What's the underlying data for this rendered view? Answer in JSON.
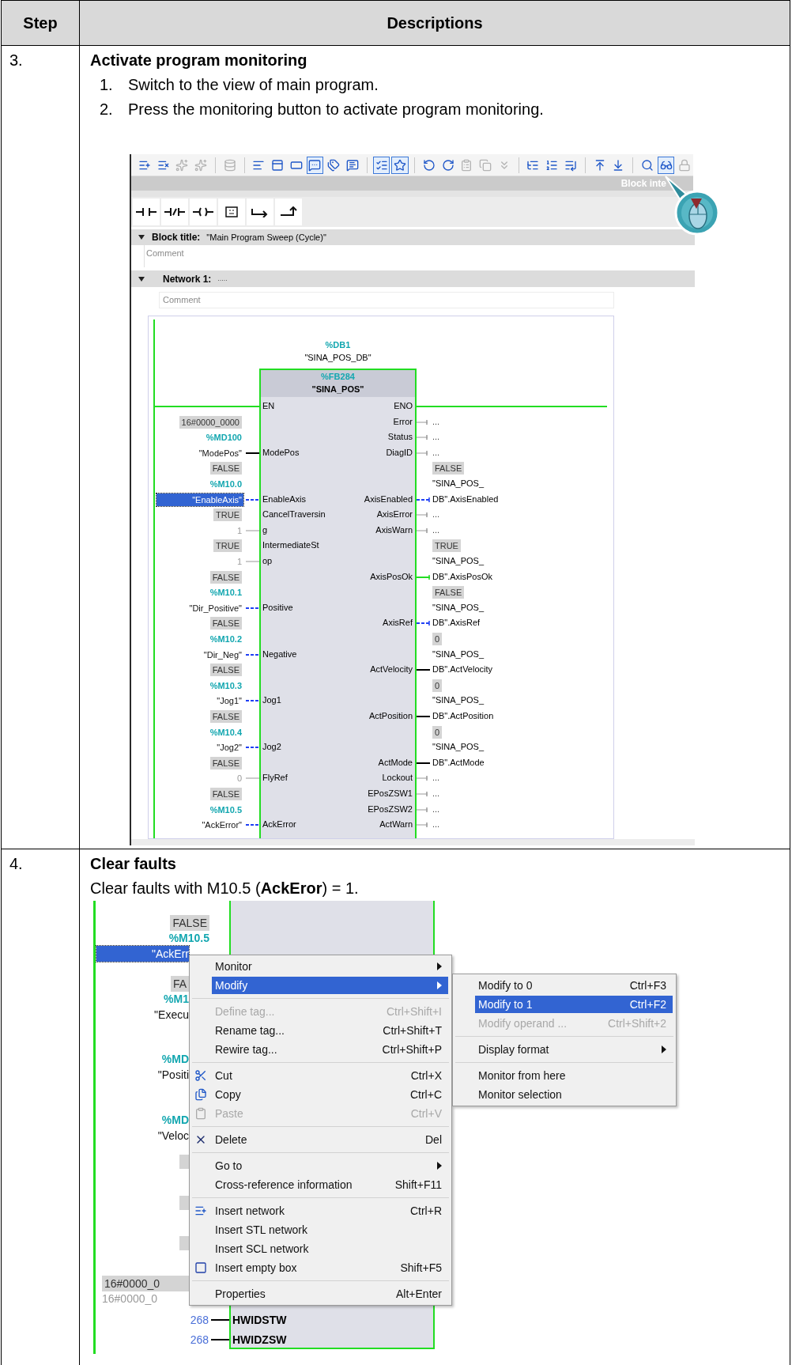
{
  "table": {
    "columns": [
      "Step",
      "Descriptions"
    ]
  },
  "rows": [
    {
      "kind": "list",
      "number": "3.",
      "title": "Activate program monitoring",
      "items": [
        {
          "marker": "1.",
          "text": "Switch to the view of main program."
        },
        {
          "marker": "2.",
          "text": "Press the monitoring button to activate program monitoring."
        }
      ],
      "editor": {
        "toolbar": [
          {
            "pressed": false,
            "disabled": false
          },
          {
            "pressed": false,
            "disabled": false
          },
          {
            "pressed": false,
            "disabled": true
          },
          {
            "pressed": false,
            "disabled": true
          },
          {
            "pressed": false,
            "disabled": true
          },
          {
            "pressed": false,
            "disabled": false
          },
          {
            "pressed": false,
            "disabled": false
          },
          {
            "pressed": false,
            "disabled": false
          },
          {
            "pressed": true,
            "disabled": false
          },
          {
            "pressed": false,
            "disabled": false
          },
          {
            "pressed": false,
            "disabled": false
          },
          {
            "pressed": true,
            "disabled": false
          },
          {
            "pressed": true,
            "disabled": false
          },
          {
            "pressed": false,
            "disabled": false
          },
          {
            "pressed": false,
            "disabled": false
          },
          {
            "pressed": false,
            "disabled": true
          },
          {
            "pressed": false,
            "disabled": true
          },
          {
            "pressed": false,
            "disabled": true
          },
          {
            "pressed": false,
            "disabled": false
          },
          {
            "pressed": false,
            "disabled": false
          },
          {
            "pressed": false,
            "disabled": false
          },
          {
            "pressed": false,
            "disabled": false
          },
          {
            "pressed": false,
            "disabled": false
          },
          {
            "pressed": false,
            "disabled": false
          },
          {
            "pressed": true,
            "disabled": false
          },
          {
            "pressed": false,
            "disabled": true
          }
        ],
        "strip_title": "Block inte",
        "block_title": {
          "expanded": true,
          "label": "Block title:",
          "value": "\"Main Program Sweep (Cycle)\"",
          "comment": "Comment"
        },
        "network": {
          "expanded": true,
          "label": "Network 1:",
          "title": ".....",
          "comment": "Comment"
        },
        "instance": {
          "address": "%DB1",
          "name": "\"SINA_POS_DB\""
        },
        "block": {
          "address": "%FB284",
          "name": "\"SINA_POS\"",
          "enable_in": "EN",
          "enable_out": "ENO"
        },
        "inputs": [
          {
            "pin": "ModePos",
            "kind": "value",
            "value": "16#0000_0000",
            "address": "%MD100",
            "operand": "\"ModePos\"",
            "selected": false
          },
          {
            "pin": "EnableAxis",
            "kind": "bool_false",
            "value": "FALSE",
            "address": "%M10.0",
            "operand": "\"EnableAxis\"",
            "selected": true
          },
          {
            "pin": "CancelTraversin\ng",
            "kind": "constant",
            "value": "TRUE",
            "operand": "1",
            "selected": false
          },
          {
            "pin": "IntermediateSt\nop",
            "kind": "constant",
            "value": "TRUE",
            "operand": "1",
            "selected": false
          },
          {
            "pin": "Positive",
            "kind": "bool_false",
            "value": "FALSE",
            "address": "%M10.1",
            "operand": "\"Dir_Positive\"",
            "selected": false
          },
          {
            "pin": "Negative",
            "kind": "bool_false",
            "value": "FALSE",
            "address": "%M10.2",
            "operand": "\"Dir_Neg\"",
            "selected": false
          },
          {
            "pin": "Jog1",
            "kind": "bool_false",
            "value": "FALSE",
            "address": "%M10.3",
            "operand": "\"Jog1\"",
            "selected": false
          },
          {
            "pin": "Jog2",
            "kind": "bool_false",
            "value": "FALSE",
            "address": "%M10.4",
            "operand": "\"Jog2\"",
            "selected": false
          },
          {
            "pin": "FlyRef",
            "kind": "constant",
            "value": "FALSE",
            "operand": "0",
            "selected": false
          },
          {
            "pin": "AckError",
            "kind": "bool_false",
            "value": "FALSE",
            "address": "%M10.5",
            "operand": "\"AckError\"",
            "selected": false
          }
        ],
        "outputs": [
          {
            "pin": "Error",
            "kind": "open",
            "operand": "..."
          },
          {
            "pin": "Status",
            "kind": "open",
            "operand": "..."
          },
          {
            "pin": "DiagID",
            "kind": "open",
            "operand": "..."
          },
          {
            "pin": "AxisEnabled",
            "kind": "bool_false",
            "value": "FALSE",
            "operand": "\"SINA_POS_\nDB\".AxisEnabled"
          },
          {
            "pin": "AxisError",
            "kind": "open",
            "operand": "..."
          },
          {
            "pin": "AxisWarn",
            "kind": "open",
            "operand": "..."
          },
          {
            "pin": "AxisPosOk",
            "kind": "bool_true",
            "value": "TRUE",
            "operand": "\"SINA_POS_\nDB\".AxisPosOk"
          },
          {
            "pin": "AxisRef",
            "kind": "bool_false",
            "value": "FALSE",
            "operand": "\"SINA_POS_\nDB\".AxisRef"
          },
          {
            "pin": "ActVelocity",
            "kind": "value",
            "value": "0",
            "operand": "\"SINA_POS_\nDB\".ActVelocity"
          },
          {
            "pin": "ActPosition",
            "kind": "value",
            "value": "0",
            "operand": "\"SINA_POS_\nDB\".ActPosition"
          },
          {
            "pin": "ActMode",
            "kind": "value",
            "value": "0",
            "operand": "\"SINA_POS_\nDB\".ActMode"
          },
          {
            "pin": "Lockout",
            "kind": "open",
            "operand": "..."
          },
          {
            "pin": "EPosZSW1",
            "kind": "open",
            "operand": "..."
          },
          {
            "pin": "EPosZSW2",
            "kind": "open",
            "operand": "..."
          },
          {
            "pin": "ActWarn",
            "kind": "open",
            "operand": "..."
          }
        ]
      }
    },
    {
      "kind": "paragraph",
      "number": "4.",
      "title": "Clear faults",
      "text": "Clear faults with M10.5 (**AckEror**) = 1.",
      "context_view": {
        "labels": [
          {
            "kind": "badge",
            "text": "FALSE"
          },
          {
            "kind": "address",
            "text": "%M10.5"
          },
          {
            "kind": "operand",
            "text": "\"AckErr",
            "selected": true
          },
          {
            "kind": "badge",
            "text": "FA"
          },
          {
            "kind": "address",
            "text": "%M1"
          },
          {
            "kind": "operand",
            "text": "\"Execu",
            "selected": false
          },
          {
            "kind": "address",
            "text": "%MD"
          },
          {
            "kind": "operand",
            "text": "\"Positi",
            "selected": false
          },
          {
            "kind": "address",
            "text": "%MD"
          },
          {
            "kind": "operand",
            "text": "\"Veloc",
            "selected": false
          },
          {
            "kind": "badge",
            "text": "16#0000_0"
          },
          {
            "kind": "constant",
            "text": "16#0000_0"
          }
        ],
        "pins": [
          {
            "constant": "268",
            "pin": "HWIDSTW"
          },
          {
            "constant": "268",
            "pin": "HWIDZSW"
          }
        ],
        "menu": [
          {
            "kind": "item",
            "label": "Monitor",
            "submenu": true,
            "selected": false,
            "disabled": false
          },
          {
            "kind": "item",
            "label": "Modify",
            "submenu": true,
            "selected": true,
            "disabled": false
          },
          {
            "kind": "separator"
          },
          {
            "kind": "item",
            "label": "Define tag...",
            "shortcut": "Ctrl+Shift+I",
            "submenu": false,
            "selected": false,
            "disabled": true
          },
          {
            "kind": "item",
            "label": "Rename tag...",
            "shortcut": "Ctrl+Shift+T",
            "submenu": false,
            "selected": false,
            "disabled": false
          },
          {
            "kind": "item",
            "label": "Rewire tag...",
            "shortcut": "Ctrl+Shift+P",
            "submenu": false,
            "selected": false,
            "disabled": false
          },
          {
            "kind": "separator"
          },
          {
            "kind": "item",
            "label": "Cut",
            "shortcut": "Ctrl+X",
            "submenu": false,
            "selected": false,
            "disabled": false
          },
          {
            "kind": "item",
            "label": "Copy",
            "shortcut": "Ctrl+C",
            "submenu": false,
            "selected": false,
            "disabled": false
          },
          {
            "kind": "item",
            "label": "Paste",
            "shortcut": "Ctrl+V",
            "submenu": false,
            "selected": false,
            "disabled": true
          },
          {
            "kind": "separator"
          },
          {
            "kind": "item",
            "label": "Delete",
            "shortcut": "Del",
            "submenu": false,
            "selected": false,
            "disabled": false
          },
          {
            "kind": "separator"
          },
          {
            "kind": "item",
            "label": "Go to",
            "submenu": true,
            "selected": false,
            "disabled": false
          },
          {
            "kind": "item",
            "label": "Cross-reference information",
            "shortcut": "Shift+F11",
            "submenu": false,
            "selected": false,
            "disabled": false
          },
          {
            "kind": "separator"
          },
          {
            "kind": "item",
            "label": "Insert network",
            "shortcut": "Ctrl+R",
            "submenu": false,
            "selected": false,
            "disabled": false
          },
          {
            "kind": "item",
            "label": "Insert STL network",
            "submenu": false,
            "selected": false,
            "disabled": false
          },
          {
            "kind": "item",
            "label": "Insert SCL network",
            "submenu": false,
            "selected": false,
            "disabled": false
          },
          {
            "kind": "item",
            "label": "Insert empty box",
            "shortcut": "Shift+F5",
            "submenu": false,
            "selected": false,
            "disabled": false
          },
          {
            "kind": "separator"
          },
          {
            "kind": "item",
            "label": "Properties",
            "shortcut": "Alt+Enter",
            "submenu": false,
            "selected": false,
            "disabled": false
          }
        ],
        "submenu": [
          {
            "kind": "item",
            "label": "Modify to 0",
            "shortcut": "Ctrl+F3",
            "submenu": false,
            "selected": false,
            "disabled": false
          },
          {
            "kind": "item",
            "label": "Modify to 1",
            "shortcut": "Ctrl+F2",
            "submenu": false,
            "selected": true,
            "disabled": false
          },
          {
            "kind": "item",
            "label": "Modify operand ...",
            "shortcut": "Ctrl+Shift+2",
            "submenu": false,
            "selected": false,
            "disabled": true
          },
          {
            "kind": "separator"
          },
          {
            "kind": "item",
            "label": "Display format",
            "submenu": true,
            "selected": false,
            "disabled": false
          },
          {
            "kind": "separator"
          },
          {
            "kind": "item",
            "label": "Monitor from here",
            "submenu": false,
            "selected": false,
            "disabled": false
          },
          {
            "kind": "item",
            "label": "Monitor selection",
            "submenu": false,
            "selected": false,
            "disabled": false
          }
        ]
      }
    }
  ]
}
